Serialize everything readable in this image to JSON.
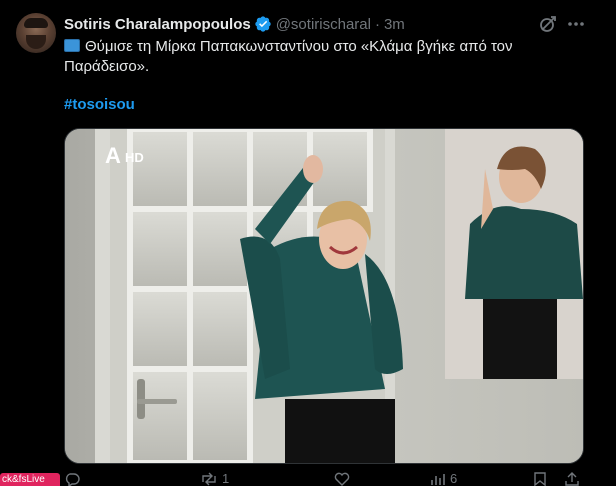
{
  "tweet": {
    "author_name": "Sotiris Charalampopoulos",
    "author_handle": "@sotirischaral",
    "separator": "·",
    "time": "3m",
    "text_line1": "Θύμισε τη Μίρκα Παπακωνσταντίνου στο «Κλάμα βγήκε από τον",
    "text_line2": "Παράδεισο».",
    "hashtag": "#tosoisou",
    "emoji": "tv-icon"
  },
  "media": {
    "channel_logo_text": "HD",
    "channel_logo_letter": "A"
  },
  "actions": {
    "reply_count": "",
    "retweet_count": "1",
    "like_count": "",
    "views_count": "6"
  },
  "left_badge": "ck&fsLive",
  "colors": {
    "background": "#000000",
    "text": "#e7e9ea",
    "muted": "#71767b",
    "accent": "#1d9bf0",
    "verified": "#1d9bf0"
  }
}
